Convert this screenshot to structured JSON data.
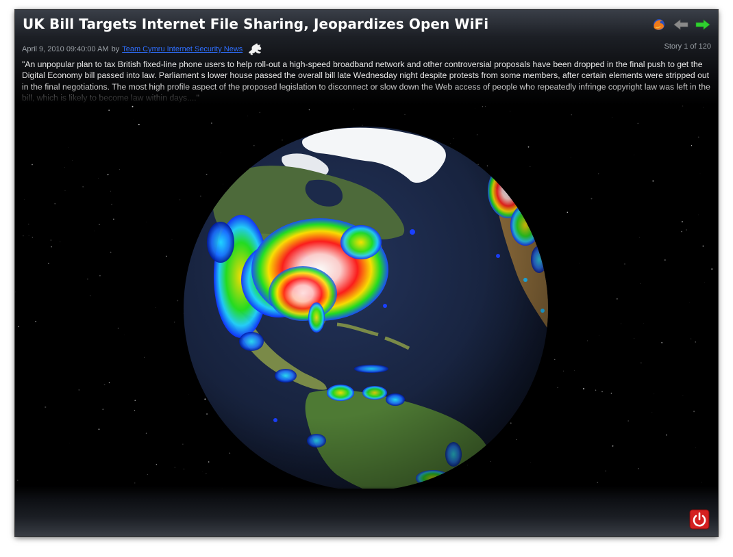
{
  "story": {
    "title": "UK Bill Targets Internet File Sharing, Jeopardizes Open WiFi",
    "date": "April 9, 2010 09:40:00 AM",
    "by_label": "by",
    "source": "Team Cymru Internet Security News",
    "counter": "Story 1 of 120",
    "excerpt": "\"An unpopular plan to tax British fixed-line phone users to help roll-out a high-speed broadband network and other controversial proposals have been dropped in the final push to get the Digital Economy bill passed into law. Parliament s lower house passed the overall bill late Wednesday night despite protests from some members, after certain elements were stripped out in the final negotiations. The most high profile aspect of the proposed legislation to disconnect or slow down the Web access of people who repeatedly infringe copyright law was left in the bill, which is likely to become law within days....\""
  },
  "nav": {
    "browser_icon": "firefox-icon",
    "prev_icon": "arrow-left-icon",
    "next_icon": "arrow-right-icon"
  },
  "footer": {
    "power_icon": "power-icon"
  },
  "colors": {
    "title_text": "#ffffff",
    "meta_text": "#9aa0a6",
    "link": "#2f6fff",
    "ocean": "#1a2540",
    "next_arrow": "#2fd12f",
    "prev_arrow": "#8a8a8a",
    "power_button": "#d42020"
  }
}
